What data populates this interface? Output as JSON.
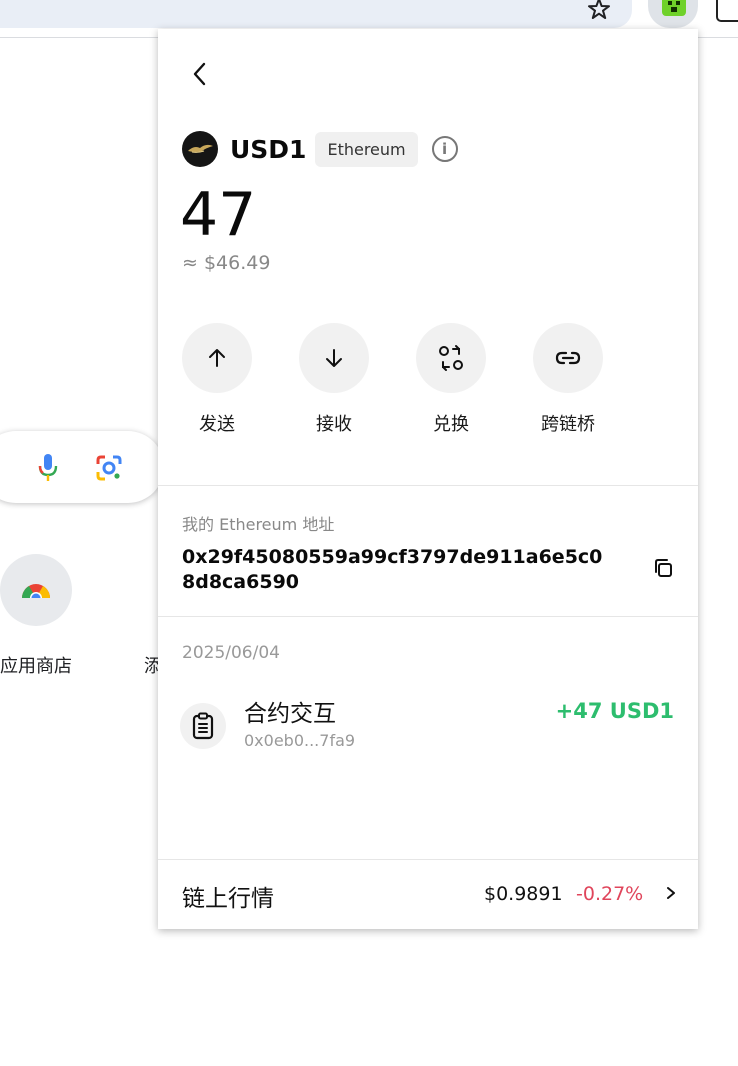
{
  "background": {
    "shortcut_labels": [
      "应用商店",
      "添"
    ]
  },
  "wallet": {
    "token": {
      "symbol": "USD1",
      "chain": "Ethereum",
      "balance": "47",
      "fiat_value": "≈ $46.49"
    },
    "actions": [
      {
        "label": "发送",
        "icon": "arrow-up-icon"
      },
      {
        "label": "接收",
        "icon": "arrow-down-icon"
      },
      {
        "label": "兑换",
        "icon": "swap-icon"
      },
      {
        "label": "跨链桥",
        "icon": "bridge-icon"
      }
    ],
    "address": {
      "title": "我的 Ethereum 地址",
      "value": "0x29f45080559a99cf3797de911a6e5c08d8ca6590"
    },
    "history": {
      "date": "2025/06/04",
      "transactions": [
        {
          "type": "合约交互",
          "hash": "0x0eb0...7fa9",
          "amount": "+47 USD1",
          "icon": "document-icon"
        }
      ]
    },
    "market": {
      "title": "链上行情",
      "price": "$0.9891",
      "change": "-0.27%"
    }
  },
  "colors": {
    "positive": "#2dbd6e",
    "negative": "#e0455b",
    "action_bg": "#f1f1f1"
  }
}
